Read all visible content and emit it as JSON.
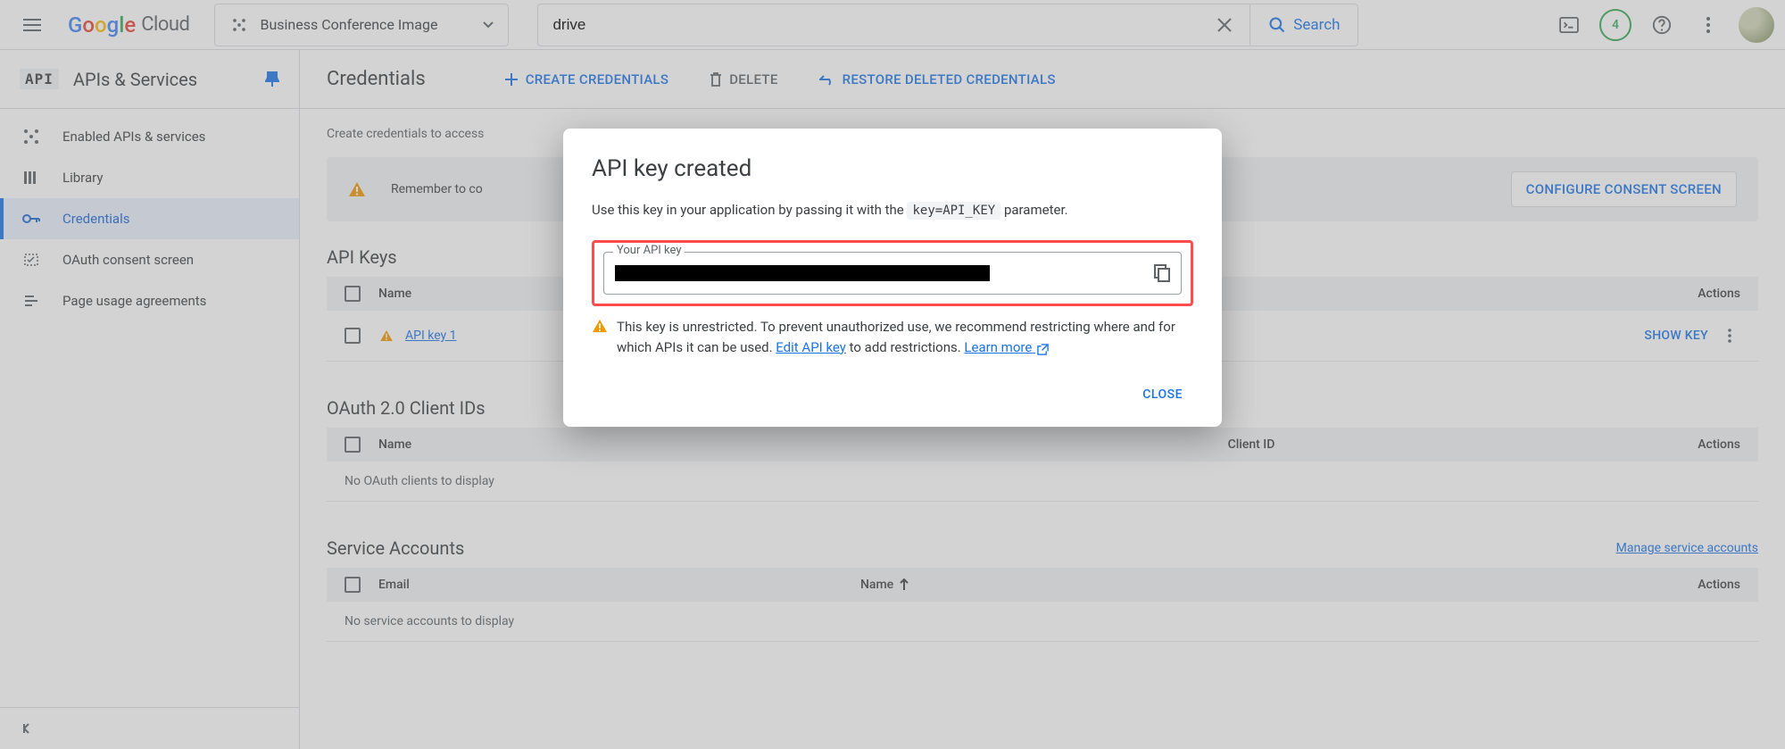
{
  "header": {
    "logo_text": "Google Cloud",
    "project_name": "Business Conference Image",
    "search_value": "drive",
    "search_button": "Search",
    "trial_count": "4"
  },
  "sidebar": {
    "api_badge": "API",
    "title": "APIs & Services",
    "items": [
      {
        "label": "Enabled APIs & services",
        "icon": "grid"
      },
      {
        "label": "Library",
        "icon": "library"
      },
      {
        "label": "Credentials",
        "icon": "key",
        "active": true
      },
      {
        "label": "OAuth consent screen",
        "icon": "consent"
      },
      {
        "label": "Page usage agreements",
        "icon": "agreement"
      }
    ]
  },
  "toolbar": {
    "page_title": "Credentials",
    "create": "CREATE CREDENTIALS",
    "delete": "DELETE",
    "restore": "RESTORE DELETED CREDENTIALS"
  },
  "content": {
    "desc": "Create credentials to access",
    "consent_banner_text": "Remember to co",
    "consent_button": "CONFIGURE CONSENT SCREEN",
    "sections": {
      "api_keys": {
        "title": "API Keys",
        "columns": {
          "name": "Name",
          "actions": "Actions"
        },
        "rows": [
          {
            "name": "API key 1",
            "show_key": "SHOW KEY"
          }
        ]
      },
      "oauth": {
        "title": "OAuth 2.0 Client IDs",
        "columns": {
          "name": "Name",
          "client_id": "Client ID",
          "actions": "Actions"
        },
        "empty": "No OAuth clients to display"
      },
      "service": {
        "title": "Service Accounts",
        "manage": "Manage service accounts",
        "columns": {
          "email": "Email",
          "name": "Name",
          "actions": "Actions"
        },
        "empty": "No service accounts to display"
      }
    }
  },
  "dialog": {
    "title": "API key created",
    "body_prefix": "Use this key in your application by passing it with the ",
    "body_code": "key=API_KEY",
    "body_suffix": " parameter.",
    "field_label": "Your API key",
    "warn_text_1": "This key is unrestricted. To prevent unauthorized use, we recommend restricting where and for which APIs it can be used. ",
    "edit_link": "Edit API key",
    "warn_text_2": " to add restrictions. ",
    "learn_more": "Learn more",
    "close": "CLOSE"
  }
}
